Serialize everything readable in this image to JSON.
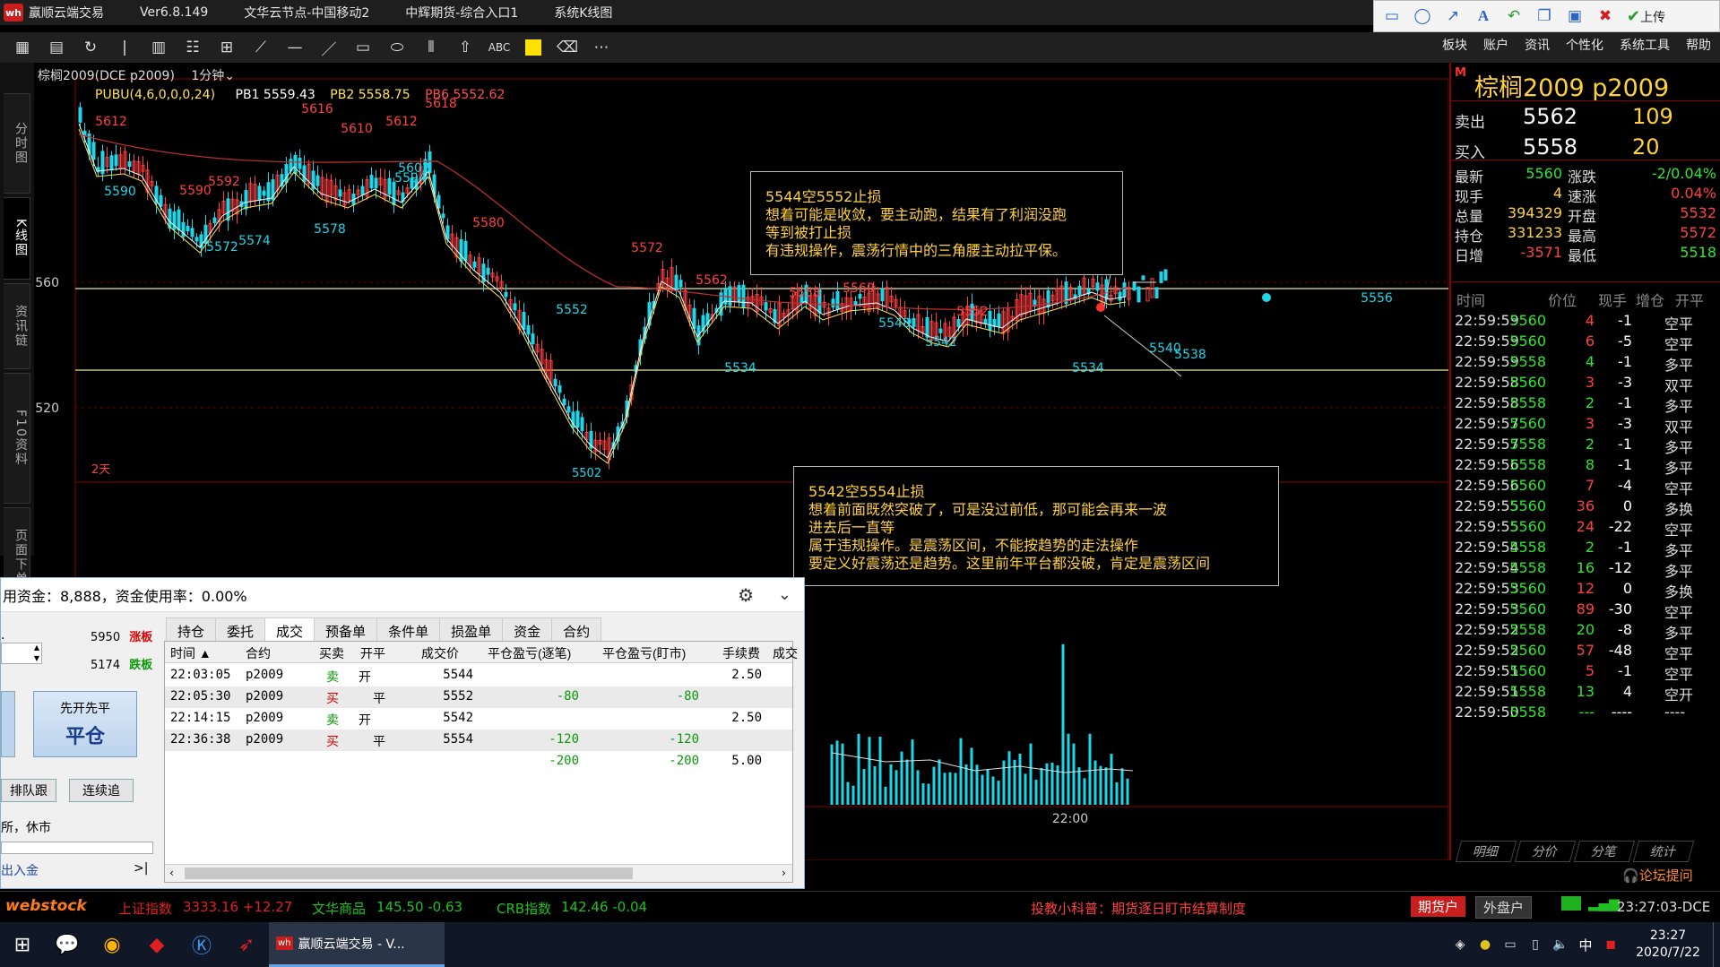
{
  "titlebar": {
    "app": "赢顺云端交易",
    "version": "Ver6.8.149",
    "node": "文华云节点-中国移动2",
    "broker": "中辉期货-综合入口1",
    "mode": "系统K线图"
  },
  "drawtools": {
    "upload": "上传"
  },
  "menu": [
    "板块",
    "账户",
    "资讯",
    "个性化",
    "系统工具",
    "帮助"
  ],
  "leftnav": [
    "分时图",
    "K线图",
    "资讯链",
    "F10资料",
    "页面下单"
  ],
  "chart": {
    "contract_label": "棕榈2009(DCE p2009)",
    "period": "1分钟",
    "indicator": {
      "name": "PUBU(4,6,0,0,0,24)",
      "pb1": "PB1 5559.43",
      "pb2": "PB2 5558.75",
      "pb6": "PB6 5552.62"
    },
    "y_labels": [
      "5560",
      "5520"
    ],
    "time_label": "22:00",
    "truncated_label": "2天",
    "truncated_low": "5502",
    "highs": [
      "5612",
      "5616",
      "5610",
      "5612",
      "5618",
      "5592",
      "5590",
      "5602",
      "5580",
      "5572",
      "5562",
      "5558",
      "5560",
      "5552",
      "5566"
    ],
    "lows": [
      "5590",
      "5572",
      "5574",
      "5578",
      "5594",
      "5552",
      "5534",
      "5548",
      "5542",
      "5534",
      "5540",
      "5538",
      "5556"
    ],
    "annotation1": {
      "title": "5544空5552止损",
      "lines": [
        "想着可能是收敛，要主动跑，结果有了利润没跑",
        "等到被打止损",
        "有违规操作，震荡行情中的三角腰主动拉平保。"
      ]
    },
    "annotation2": {
      "title": "5542空5554止损",
      "lines": [
        "想着前面既然突破了，可是没过前低，那可能会再来一波",
        "进去后一直等",
        "属于违规操作。是震荡区间，不能按趋势的走法操作",
        "要定义好震荡还是趋势。这里前年平台都没破，肯定是震荡区间"
      ]
    },
    "colors": {
      "up": "#ff4040",
      "down": "#1fd6e8",
      "ma1": "#ffffff",
      "ma2": "#ffe45a",
      "ma3": "#c03030",
      "hline": "#e8e6a0"
    }
  },
  "quote": {
    "mark": "M",
    "name": "棕榈2009   p2009",
    "ask_label": "卖出",
    "ask_price": "5562",
    "ask_vol": "109",
    "bid_label": "买入",
    "bid_price": "5558",
    "bid_vol": "20",
    "fields_left": [
      {
        "label": "最新",
        "value": "5560"
      },
      {
        "label": "现手",
        "value": "4"
      },
      {
        "label": "总量",
        "value": "394329"
      },
      {
        "label": "持仓",
        "value": "331233"
      },
      {
        "label": "日增",
        "value": "-3571"
      }
    ],
    "fields_right": [
      {
        "label": "涨跌",
        "value": "-2/0.04%"
      },
      {
        "label": "速涨",
        "value": "0.04%"
      },
      {
        "label": "开盘",
        "value": "5532"
      },
      {
        "label": "最高",
        "value": "5572"
      },
      {
        "label": "最低",
        "value": "5518"
      }
    ],
    "tick_headers": [
      "时间",
      "价位",
      "现手",
      "增仓",
      "开平"
    ],
    "ticks": [
      [
        "22:59:59",
        "5560",
        "4",
        "-1",
        "空平"
      ],
      [
        "22:59:59",
        "5560",
        "6",
        "-5",
        "空平"
      ],
      [
        "22:59:59",
        "5558",
        "4",
        "-1",
        "多平"
      ],
      [
        "22:59:58",
        "5560",
        "3",
        "-3",
        "双平"
      ],
      [
        "22:59:58",
        "5558",
        "2",
        "-1",
        "多平"
      ],
      [
        "22:59:57",
        "5560",
        "3",
        "-3",
        "双平"
      ],
      [
        "22:59:57",
        "5558",
        "2",
        "-1",
        "多平"
      ],
      [
        "22:59:56",
        "5558",
        "8",
        "-1",
        "多平"
      ],
      [
        "22:59:56",
        "5560",
        "7",
        "-4",
        "空平"
      ],
      [
        "22:59:55",
        "5560",
        "36",
        "0",
        "多换"
      ],
      [
        "22:59:55",
        "5560",
        "24",
        "-22",
        "空平"
      ],
      [
        "22:59:54",
        "5558",
        "2",
        "-1",
        "多平"
      ],
      [
        "22:59:54",
        "5558",
        "16",
        "-12",
        "多平"
      ],
      [
        "22:59:53",
        "5560",
        "12",
        "0",
        "多换"
      ],
      [
        "22:59:53",
        "5560",
        "89",
        "-30",
        "空平"
      ],
      [
        "22:59:52",
        "5558",
        "20",
        "-8",
        "多平"
      ],
      [
        "22:59:52",
        "5560",
        "57",
        "-48",
        "空平"
      ],
      [
        "22:59:51",
        "5560",
        "5",
        "-1",
        "空平"
      ],
      [
        "22:59:51",
        "5558",
        "13",
        "4",
        "空开"
      ],
      [
        "22:59:50",
        "5558",
        "---",
        "----",
        "----"
      ]
    ],
    "tabs": [
      "明细",
      "分价",
      "分笔",
      "统计"
    ],
    "forum": "论坛提问"
  },
  "trade": {
    "header": "用资金：8,888，资金使用率：0.00%",
    "limit_up_price": "5950",
    "limit_up": "涨板",
    "limit_down_price": "5174",
    "limit_down": "跌板",
    "btn_top": "先开先平",
    "btn_main": "平仓",
    "queue_btn": "排队跟",
    "cont_btn": "连续追",
    "exchange_status": "所，休市",
    "deposit": "出入金",
    "tabs": [
      "持仓",
      "委托",
      "成交",
      "预备单",
      "条件单",
      "损盈单",
      "资金",
      "合约"
    ],
    "columns": [
      "时间 ▲",
      "合约",
      "买卖",
      "开平",
      "成交价",
      "平仓盈亏(逐笔)",
      "平仓盈亏(盯市)",
      "手续费",
      "成交"
    ],
    "rows": [
      [
        "22:03:05",
        "p2009",
        "卖",
        "开",
        "5544",
        "",
        "",
        "2.50"
      ],
      [
        "22:05:30",
        "p2009",
        "买",
        "平",
        "5552",
        "-80",
        "-80",
        ""
      ],
      [
        "22:14:15",
        "p2009",
        "卖",
        "开",
        "5542",
        "",
        "",
        "2.50"
      ],
      [
        "22:36:38",
        "p2009",
        "买",
        "平",
        "5554",
        "-120",
        "-120",
        ""
      ],
      [
        "",
        "",
        "",
        "",
        "",
        "-200",
        "-200",
        "5.00"
      ]
    ]
  },
  "statusbar": {
    "brand": "webstock",
    "sh_label": "上证指数",
    "sh_val": "3333.16 +12.27",
    "wh_label": "文华商品",
    "wh_val": "145.50 -0.63",
    "crb_label": "CRB指数",
    "crb_val": "142.46 -0.04",
    "tip": "投教小科普：期货逐日盯市结算制度",
    "acct1": "期货户",
    "acct2": "外盘户",
    "clock": "23:27:03-DCE"
  },
  "taskbar": {
    "active": "赢顺云端交易 - V...",
    "ime": "中",
    "time": "23:27",
    "date": "2020/7/22"
  }
}
